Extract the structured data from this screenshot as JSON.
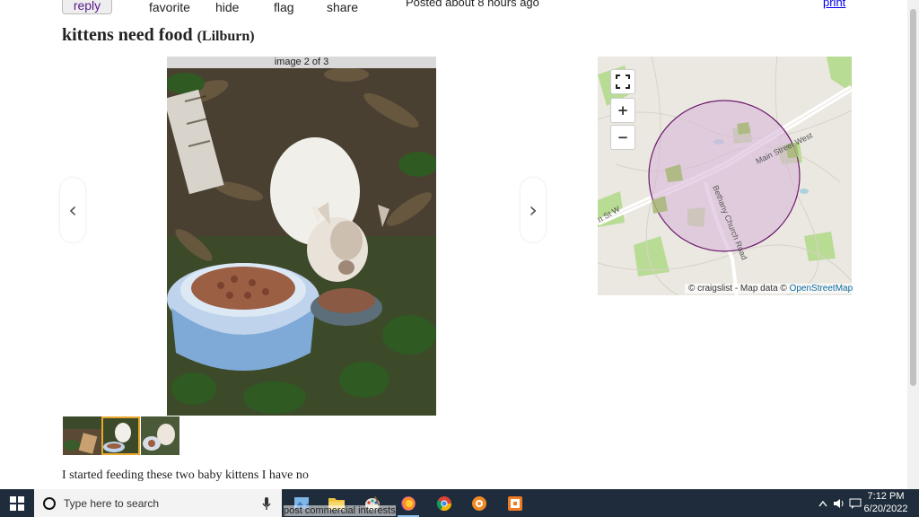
{
  "actions": {
    "reply": "reply",
    "favorite": "favorite",
    "hide": "hide",
    "flag": "flag",
    "share": "share",
    "posted": "Posted about 8 hours ago",
    "print": "print"
  },
  "post": {
    "title": "kittens need food",
    "location": "(Lilburn)",
    "body_preview": "I started feeding these two baby kittens I have no"
  },
  "gallery": {
    "counter": "image 2 of 3",
    "prev_arrow": "‹",
    "next_arrow": "›",
    "thumbnail_count": 3,
    "selected_thumbnail": 2
  },
  "map": {
    "expand_icon": "expand-icon",
    "zoom_in": "+",
    "zoom_out": "−",
    "street_1": "Main Street West",
    "street_2": "Bethany Church Road",
    "street_3": "n St W",
    "attribution_prefix": "© craigslist - Map data © ",
    "attribution_link": "OpenStreetMap",
    "circle_color": "#6b1a6b",
    "circle_fill": "#d8b8d8"
  },
  "taskbar": {
    "search_placeholder": "Type here to search",
    "overlay": "post commercial interests",
    "time": "7:12 PM",
    "date": "6/20/2022"
  }
}
